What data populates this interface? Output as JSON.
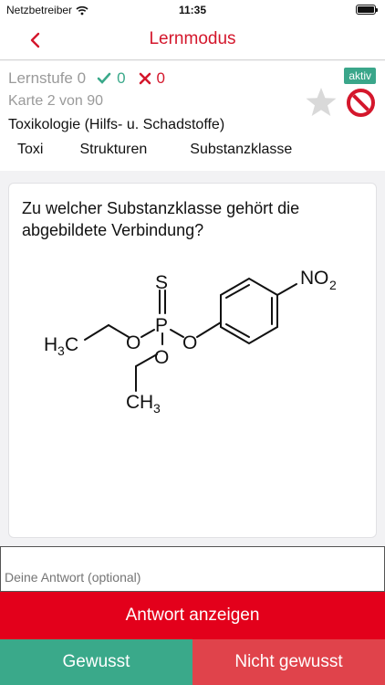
{
  "status_bar": {
    "carrier": "Netzbetreiber",
    "time": "11:35"
  },
  "nav": {
    "title": "Lernmodus"
  },
  "info": {
    "lernstufe": "Lernstufe 0",
    "correct_count": "0",
    "wrong_count": "0",
    "karte": "Karte 2 von 90",
    "kategorie": "Toxikologie (Hilfs- u. Schadstoffe)",
    "aktiv_badge": "aktiv",
    "tags": [
      "Toxi",
      "Strukturen",
      "Substanzklasse"
    ]
  },
  "card": {
    "question": "Zu welcher Substanzklasse gehört die abgebildete Verbindung?",
    "structure_labels": {
      "s": "S",
      "p": "P",
      "o": "O",
      "h": "H",
      "c": "C",
      "n": "N",
      "no2_o": "O",
      "sub3": "3",
      "sub2": "2"
    }
  },
  "answer_field": {
    "placeholder": "Deine Antwort (optional)"
  },
  "buttons": {
    "show_answer": "Antwort anzeigen",
    "known": "Gewusst",
    "unknown": "Nicht gewusst"
  },
  "colors": {
    "accent_red": "#d4172c",
    "primary_red": "#e3001b",
    "green": "#3aa98a",
    "light_red": "#e0434b"
  }
}
